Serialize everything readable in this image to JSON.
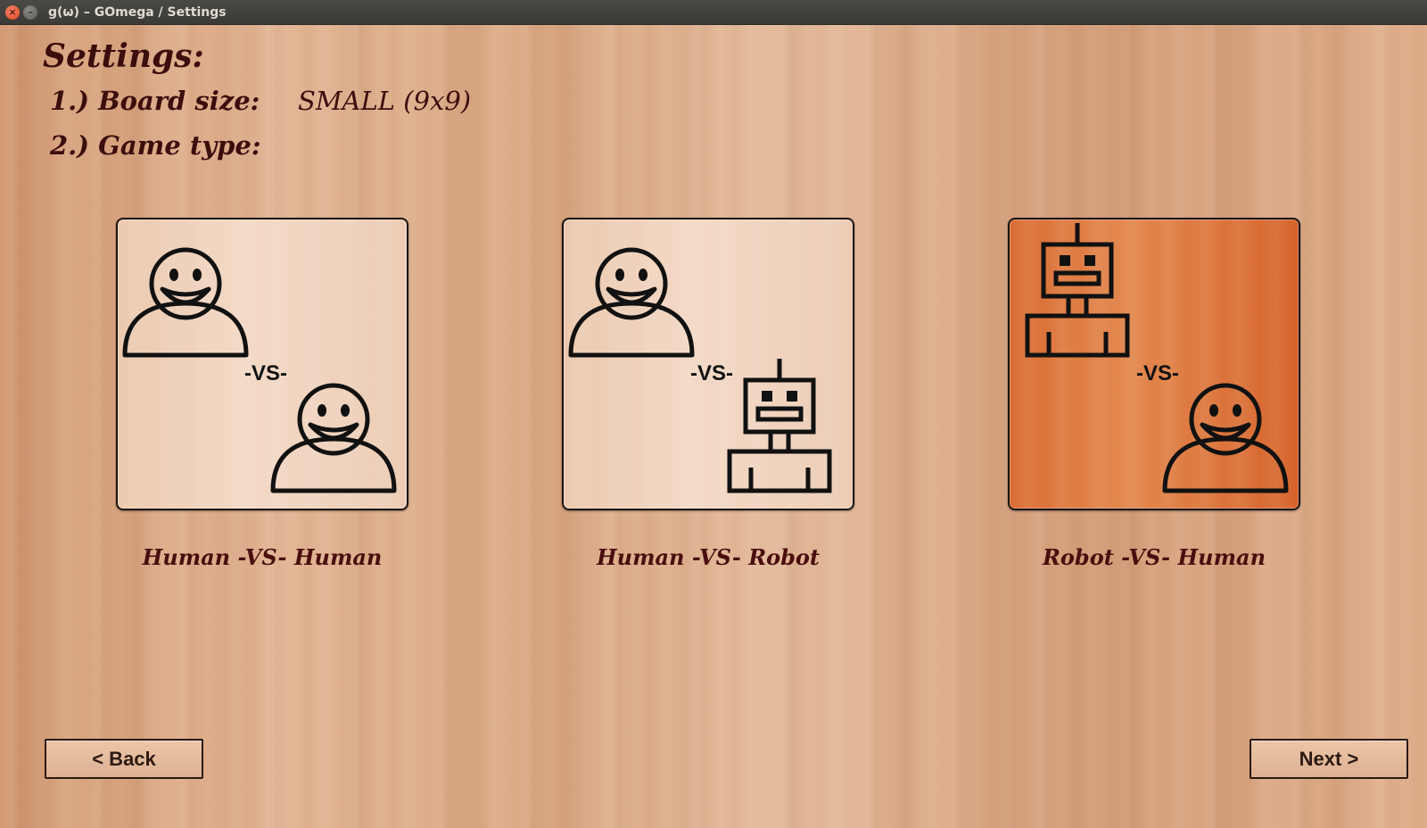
{
  "window": {
    "title": "g(ω) – GOmega / Settings",
    "close_glyph": "×",
    "minimize_glyph": "–"
  },
  "settings": {
    "title": "Settings:",
    "board_size_label": "1.) Board size:",
    "board_size_value": "SMALL (9x9)",
    "game_type_label": "2.) Game type:"
  },
  "game_types": [
    {
      "label": "Human -VS- Human",
      "vs_text": "-VS-",
      "player1": "human",
      "player2": "human",
      "selected": false
    },
    {
      "label": "Human -VS- Robot",
      "vs_text": "-VS-",
      "player1": "human",
      "player2": "robot",
      "selected": false
    },
    {
      "label": "Robot -VS- Human",
      "vs_text": "-VS-",
      "player1": "robot",
      "player2": "human",
      "selected": true
    }
  ],
  "buttons": {
    "back": "< Back",
    "next": "Next >"
  },
  "colors": {
    "card_normal": "#f0d2bc",
    "card_selected": "#dc7238",
    "text_dark_red": "#4a0e0e",
    "icon_stroke": "#111111"
  },
  "icons": {
    "human": "human-icon",
    "robot": "robot-icon"
  }
}
